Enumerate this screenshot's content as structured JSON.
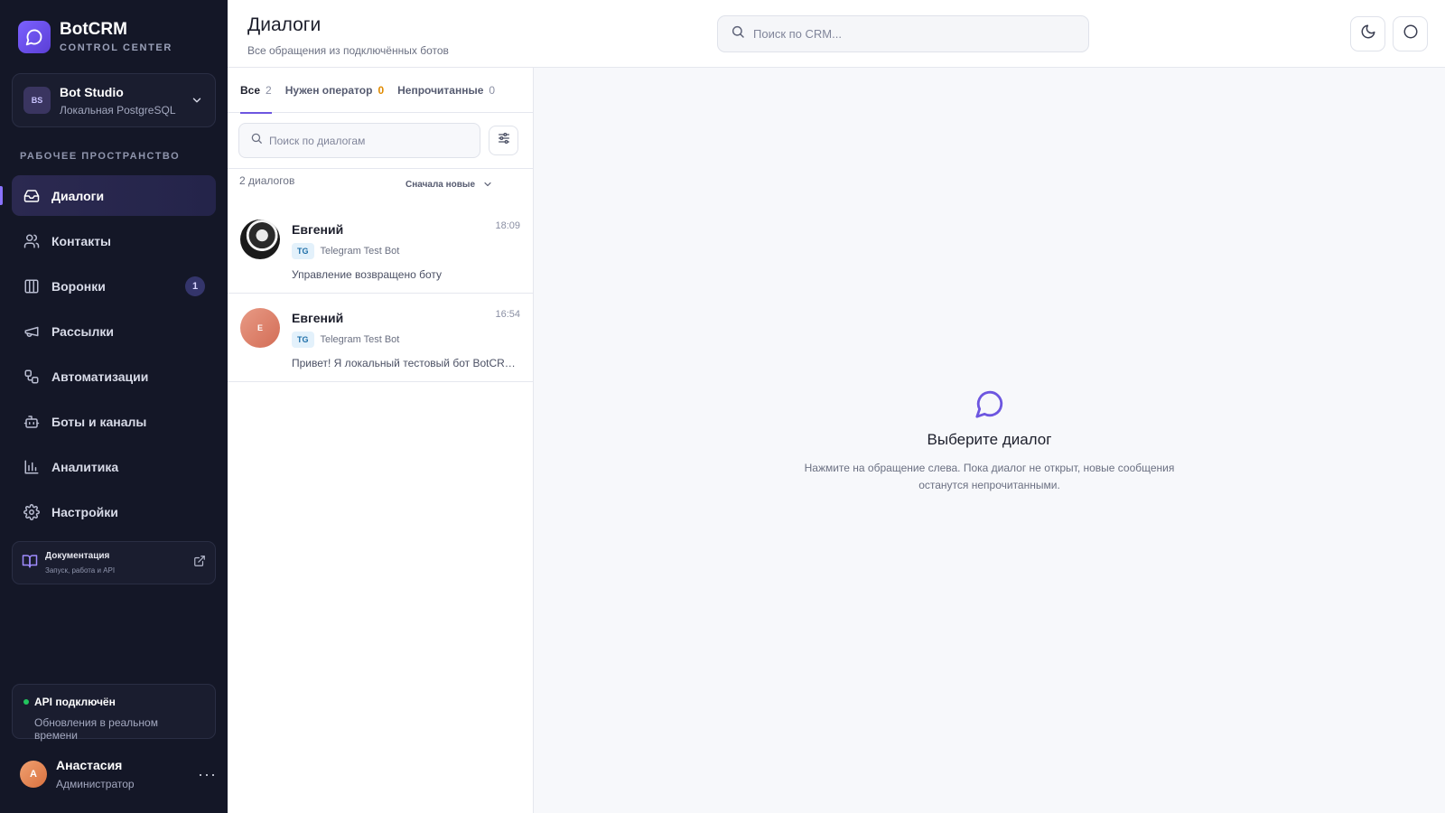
{
  "brand": {
    "name": "BotCRM",
    "subtitle": "CONTROL CENTER"
  },
  "workspace": {
    "badge": "BS",
    "name": "Bot Studio",
    "db": "Локальная PostgreSQL"
  },
  "sidebar": {
    "section_label": "РАБОЧЕЕ ПРОСТРАНСТВО",
    "items": [
      {
        "label": "Диалоги",
        "icon": "inbox-icon",
        "active": true
      },
      {
        "label": "Контакты",
        "icon": "users-icon"
      },
      {
        "label": "Воронки",
        "icon": "kanban-icon",
        "count": "1"
      },
      {
        "label": "Рассылки",
        "icon": "megaphone-icon"
      },
      {
        "label": "Автоматизации",
        "icon": "workflow-icon"
      },
      {
        "label": "Боты и каналы",
        "icon": "bot-icon"
      },
      {
        "label": "Аналитика",
        "icon": "bar-chart-icon"
      },
      {
        "label": "Настройки",
        "icon": "gear-icon"
      }
    ],
    "docs": {
      "title": "Документация",
      "subtitle": "Запуск, работа и API"
    },
    "api": {
      "title": "API подключён",
      "subtitle": "Обновления в реальном времени",
      "status_color": "#22c55e"
    },
    "user": {
      "initial": "А",
      "name": "Анастасия",
      "role": "Администратор",
      "more": "···"
    }
  },
  "header": {
    "title": "Диалоги",
    "subtitle": "Все обращения из подключённых ботов",
    "search_placeholder": "Поиск по CRM..."
  },
  "dialogs": {
    "tabs": [
      {
        "label": "Все",
        "count": "2",
        "active": true
      },
      {
        "label": "Нужен оператор",
        "count": "0",
        "warn": true
      },
      {
        "label": "Непрочитанные",
        "count": "0"
      }
    ],
    "search_placeholder": "Поиск по диалогам",
    "count_text": "2 диалогов",
    "sort_label": "Сначала новые",
    "items": [
      {
        "name": "Евгений",
        "time": "18:09",
        "channel": "TG",
        "bot": "Telegram Test Bot",
        "message": "Управление возвращено боту",
        "avatar": "photo"
      },
      {
        "name": "Евгений",
        "time": "16:54",
        "channel": "TG",
        "bot": "Telegram Test Bot",
        "message": "Привет! Я локальный тестовый бот BotCRM. Напишите что-нибудь",
        "avatar": "init",
        "initial": "Е"
      }
    ]
  },
  "empty_state": {
    "title": "Выберите диалог",
    "description": "Нажмите на обращение слева. Пока диалог не открыт, новые сообщения останутся непрочитанными."
  },
  "colors": {
    "accent": "#6d56e0",
    "sidebar_bg": "#141727",
    "warn": "#e08a00",
    "telegram": "#1e6fa8"
  }
}
